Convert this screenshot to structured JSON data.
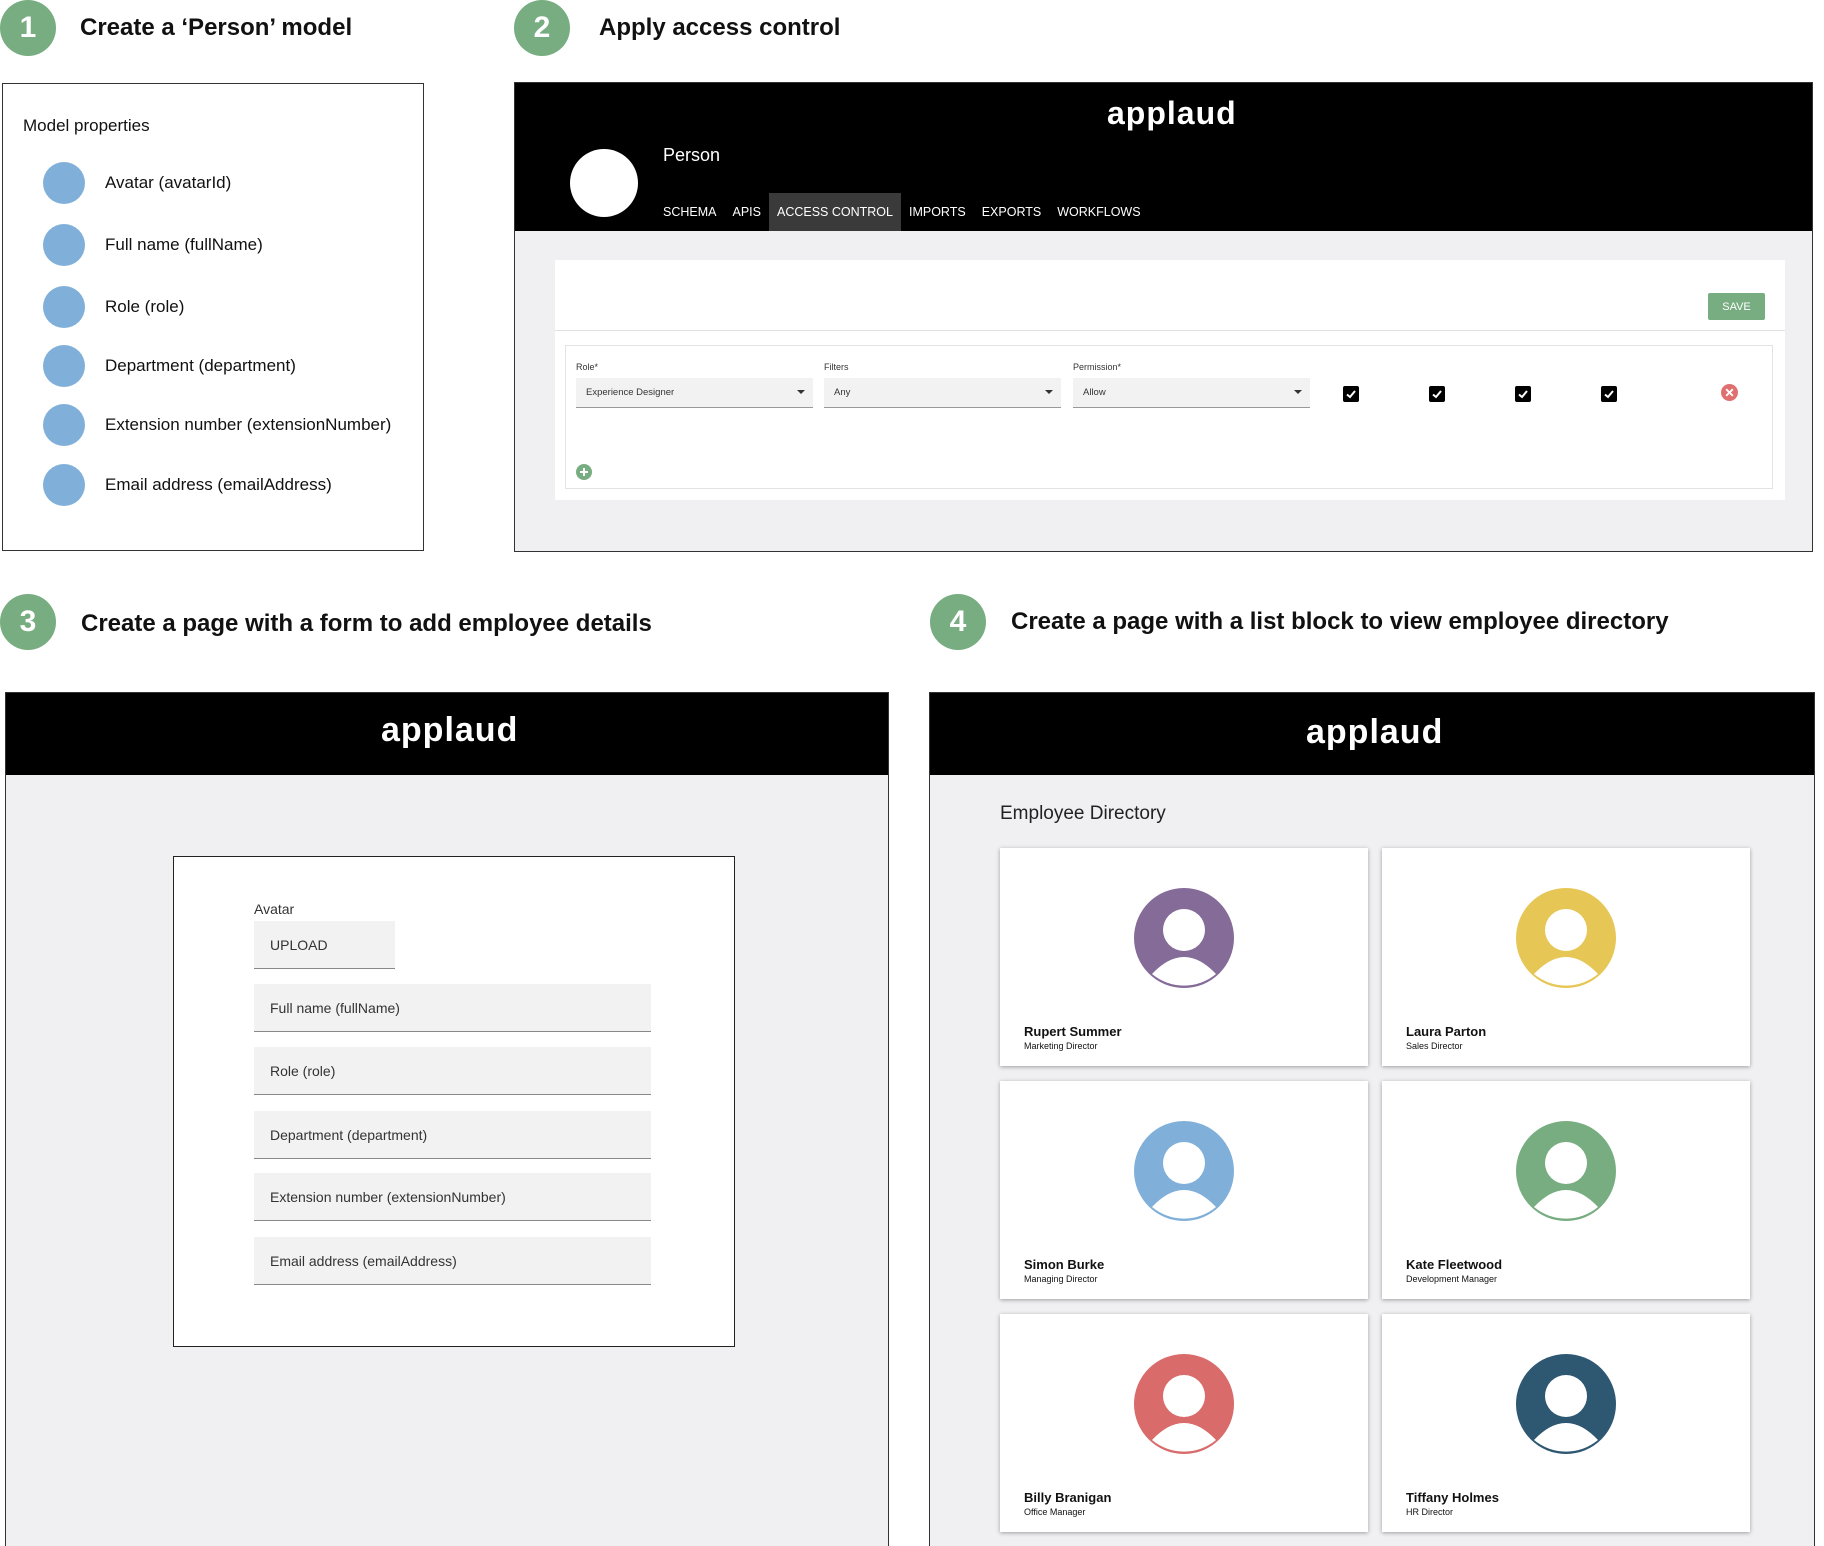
{
  "steps": [
    {
      "number": "1",
      "title": "Create a ‘Person’ model"
    },
    {
      "number": "2",
      "title": "Apply access control"
    },
    {
      "number": "3",
      "title": "Create a page with a form to add employee details"
    },
    {
      "number": "4",
      "title": "Create a page with a list block to view employee directory"
    }
  ],
  "model": {
    "heading": "Model properties",
    "properties": [
      "Avatar (avatarId)",
      "Full name (fullName)",
      "Role (role)",
      "Department (department)",
      "Extension number (extensionNumber)",
      "Email address (emailAddress)"
    ],
    "dot_color": "#80b0d9"
  },
  "app": {
    "logo": "applaud"
  },
  "access_control": {
    "model_name": "Person",
    "tabs": [
      "SCHEMA",
      "APIS",
      "ACCESS CONTROL",
      "IMPORTS",
      "EXPORTS",
      "WORKFLOWS"
    ],
    "active_tab": "ACCESS CONTROL",
    "save_label": "SAVE",
    "rule": {
      "role_label": "Role*",
      "role_value": "Experience Designer",
      "filters_label": "Filters",
      "filters_value": "Any",
      "permission_label": "Permission*",
      "permission_value": "Allow",
      "checkboxes": [
        true,
        true,
        true,
        true
      ]
    }
  },
  "form": {
    "avatar_label": "Avatar",
    "upload_label": "UPLOAD",
    "fields": [
      "Full name (fullName)",
      "Role (role)",
      "Department (department)",
      "Extension number (extensionNumber)",
      "Email address (emailAddress)"
    ]
  },
  "directory": {
    "title": "Employee Directory",
    "employees": [
      {
        "name": "Rupert Summer",
        "role": "Marketing Director",
        "color": "#846b98"
      },
      {
        "name": "Laura Parton",
        "role": "Sales Director",
        "color": "#e6c655"
      },
      {
        "name": "Simon Burke",
        "role": "Managing Director",
        "color": "#80b0d9"
      },
      {
        "name": "Kate Fleetwood",
        "role": "Development Manager",
        "color": "#77ad80"
      },
      {
        "name": "Billy Branigan",
        "role": "Office Manager",
        "color": "#d96b6b"
      },
      {
        "name": "Tiffany Holmes",
        "role": "HR Director",
        "color": "#2e5872"
      }
    ]
  },
  "colors": {
    "accent_green": "#77ad80",
    "remove_red": "#e07070"
  }
}
